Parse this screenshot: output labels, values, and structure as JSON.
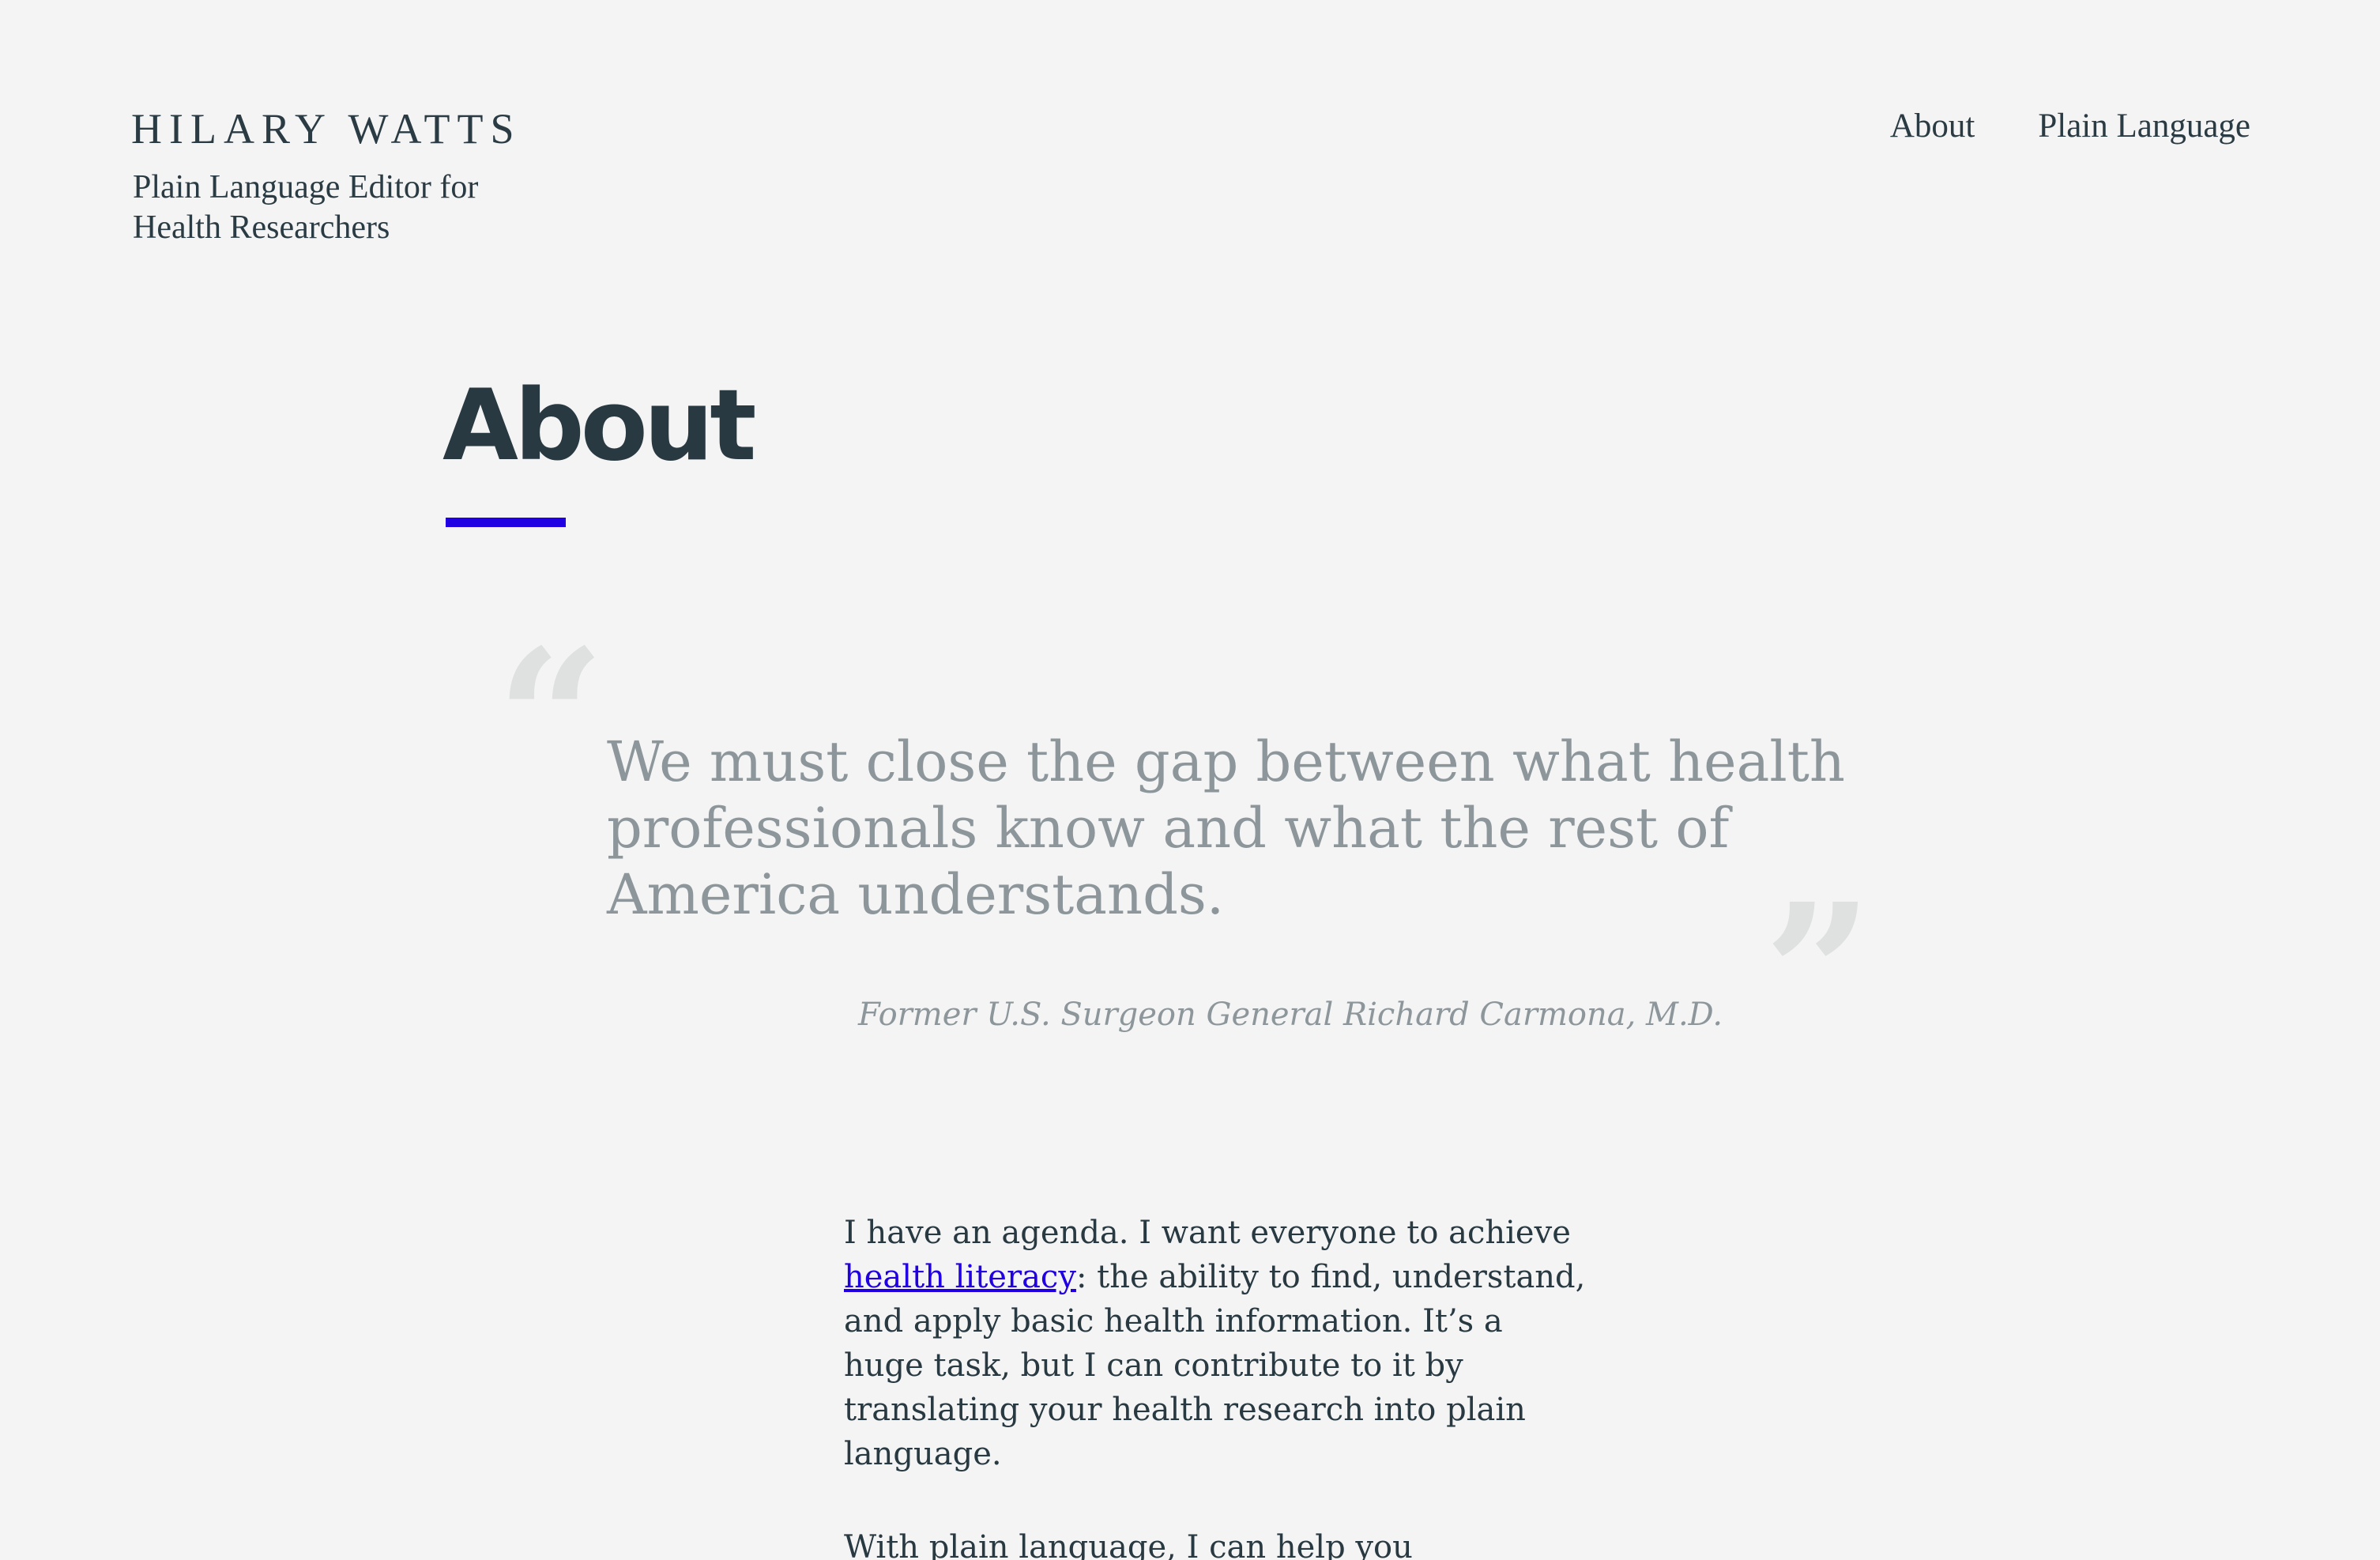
{
  "site": {
    "title": "HILARY WATTS",
    "tagline": "Plain Language Editor for Health Researchers"
  },
  "nav": {
    "items": [
      {
        "label": "About"
      },
      {
        "label": "Plain Language"
      }
    ]
  },
  "page": {
    "title": "About",
    "accent_color": "#2000e2"
  },
  "quote": {
    "open_mark": "“",
    "close_mark": "”",
    "text": "We must close the gap between what health professionals know and what the rest of America understands.",
    "citation": "Former U.S. Surgeon General Richard Carmona, M.D."
  },
  "body": {
    "para1_before": "I have an agenda. I want everyone to achieve ",
    "para1_link": "health literacy",
    "para1_after": ": the ability to find, understand, and apply basic health information. It’s a huge task, but I can contribute to it by translating your health research into plain language.",
    "para2": "With plain language, I can help you communicate"
  }
}
